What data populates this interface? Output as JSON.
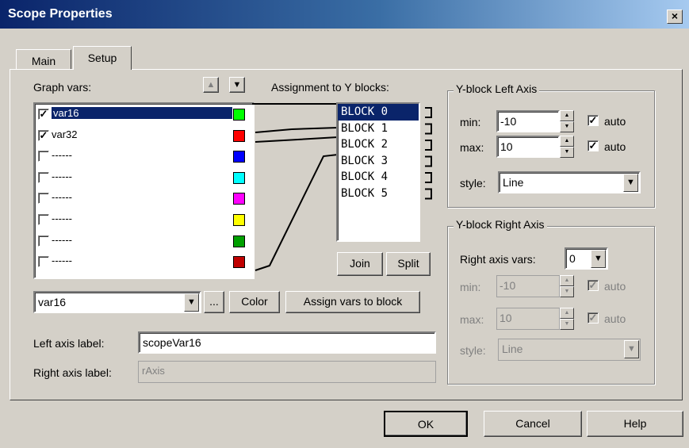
{
  "window": {
    "title": "Scope Properties",
    "close_label": "×"
  },
  "tabs": [
    {
      "label": "Main"
    },
    {
      "label": "Setup"
    }
  ],
  "graph_vars": {
    "label": "Graph vars:",
    "items": [
      {
        "name": "var16",
        "checked": true,
        "color": "#00ff00"
      },
      {
        "name": "var32",
        "checked": true,
        "color": "#ff0000"
      },
      {
        "name": "------",
        "checked": false,
        "color": "#0000ff"
      },
      {
        "name": "------",
        "checked": false,
        "color": "#00ffff"
      },
      {
        "name": "------",
        "checked": false,
        "color": "#ff00ff"
      },
      {
        "name": "------",
        "checked": false,
        "color": "#ffff00"
      },
      {
        "name": "------",
        "checked": false,
        "color": "#00a000"
      },
      {
        "name": "------",
        "checked": false,
        "color": "#c00000"
      }
    ],
    "selected_var": "var16",
    "ellipsis_label": "...",
    "color_button": "Color",
    "assign_button": "Assign vars to block"
  },
  "assignment": {
    "label": "Assignment to Y blocks:",
    "blocks": [
      "BLOCK 0",
      "BLOCK 1",
      "BLOCK 2",
      "BLOCK 3",
      "BLOCK 4",
      "BLOCK 5"
    ],
    "join_button": "Join",
    "split_button": "Split"
  },
  "labels": {
    "left_axis_label": "Left axis label:",
    "left_axis_value": "scopeVar16",
    "right_axis_label": "Right axis label:",
    "right_axis_value": "rAxis"
  },
  "left_axis": {
    "title": "Y-block Left Axis",
    "min_label": "min:",
    "min_value": "-10",
    "min_auto": "auto",
    "max_label": "max:",
    "max_value": "10",
    "max_auto": "auto",
    "style_label": "style:",
    "style_value": "Line"
  },
  "right_axis": {
    "title": "Y-block Right Axis",
    "vars_label": "Right axis vars:",
    "vars_value": "0",
    "min_label": "min:",
    "min_value": "-10",
    "min_auto": "auto",
    "max_label": "max:",
    "max_value": "10",
    "max_auto": "auto",
    "style_label": "style:",
    "style_value": "Line"
  },
  "footer": {
    "ok": "OK",
    "cancel": "Cancel",
    "help": "Help"
  }
}
